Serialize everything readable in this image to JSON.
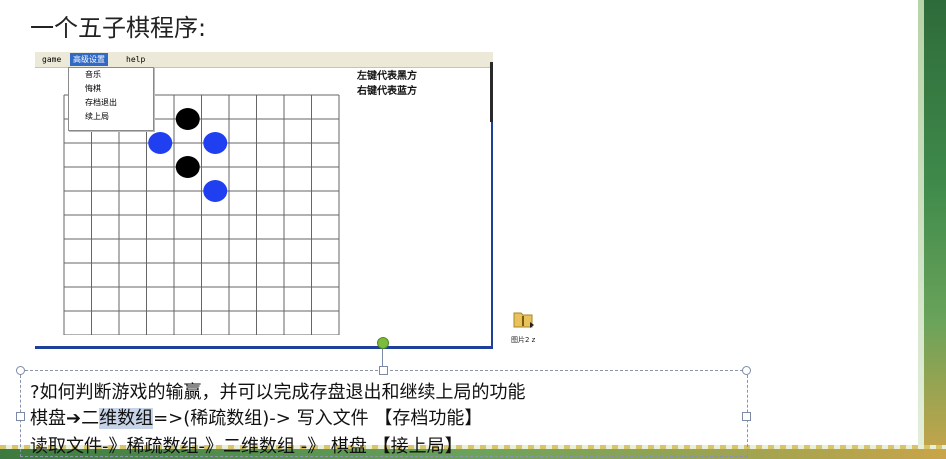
{
  "slide": {
    "title": "一个五子棋程序:"
  },
  "app": {
    "menus": [
      {
        "label": "game",
        "active": false
      },
      {
        "label": "高级设置",
        "active": true
      },
      {
        "label": "help",
        "active": false
      }
    ],
    "dropdown_items": [
      "音乐",
      "悔棋",
      "存档退出",
      "续上局"
    ],
    "legend": [
      "左键代表黑方",
      "右键代表蓝方"
    ],
    "board": {
      "columns": 10,
      "rows": 11,
      "stones": [
        {
          "col": 4,
          "row": 1,
          "color": "black"
        },
        {
          "col": 3,
          "row": 2,
          "color": "blue"
        },
        {
          "col": 5,
          "row": 2,
          "color": "blue"
        },
        {
          "col": 4,
          "row": 3,
          "color": "black"
        },
        {
          "col": 5,
          "row": 4,
          "color": "blue"
        }
      ],
      "black_color": "#000000",
      "blue_color": "#1f3ff0"
    }
  },
  "desktop_file": {
    "label": "图片2 z",
    "icon": "folder-zip-icon"
  },
  "textbox": {
    "line1": "?如何判断游戏的输赢，并可以完成存盘退出和继续上局的功能",
    "line2_a": "棋盘",
    "line2_arrow": "➔",
    "line2_b": "二",
    "line2_hl": "维数组",
    "line2_c": "=>(稀疏数组)-> 写入文件  【存档功能】",
    "line3": "读取文件-》稀疏数组-》二维数组 -》 棋盘 【接上局】"
  }
}
